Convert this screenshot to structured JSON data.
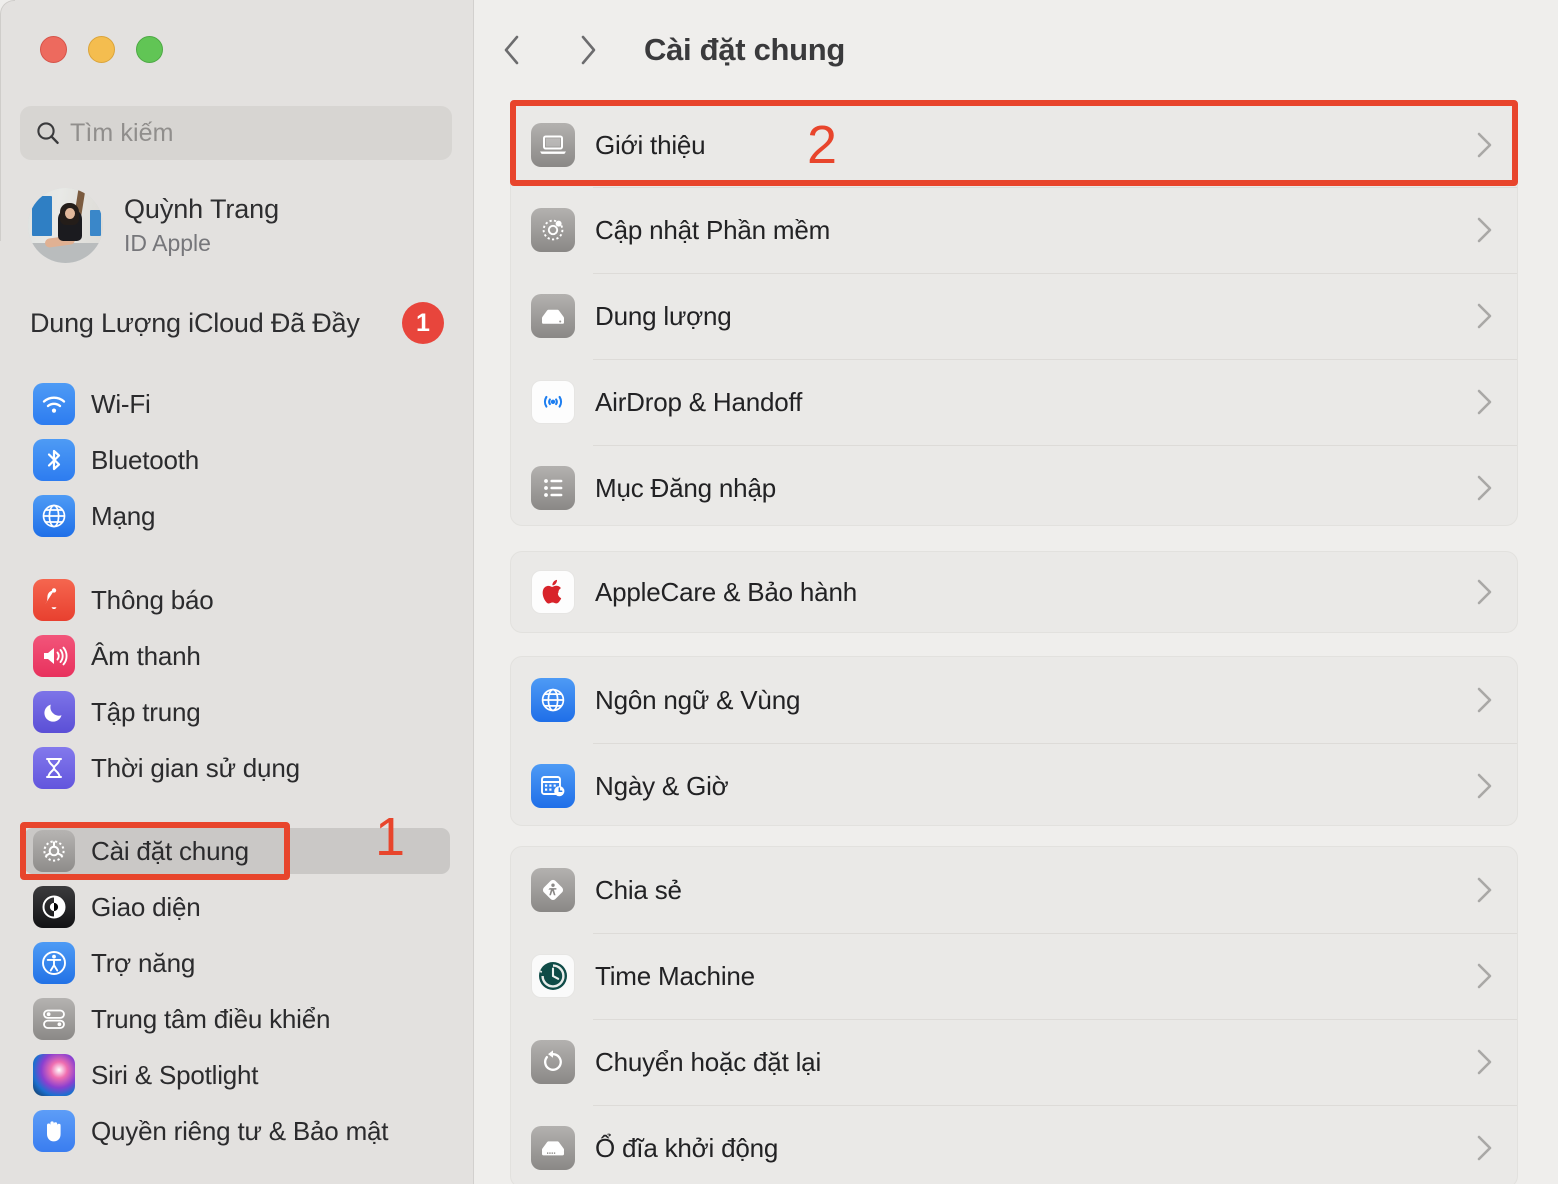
{
  "window": {
    "traffic_lights": [
      "close",
      "minimize",
      "zoom"
    ],
    "colors": {
      "close": "#ed6a5e",
      "minimize": "#f4bd4f",
      "zoom": "#61c555",
      "accent_annotation": "#e8452c",
      "badge_red": "#e8453c",
      "sidebar_bg": "#e3e1df",
      "content_bg": "#efeeec",
      "card_bg": "#eae9e7"
    }
  },
  "sidebar": {
    "search": {
      "placeholder": "Tìm kiếm",
      "icon": "search-icon"
    },
    "profile": {
      "name": "Quỳnh Trang",
      "subtitle": "ID Apple",
      "avatar": "user-avatar"
    },
    "icloud_notice": {
      "label": "Dung Lượng iCloud Đã Đầy",
      "badge": "1"
    },
    "groups": [
      {
        "items": [
          {
            "label": "Wi-Fi",
            "icon": "wifi-icon",
            "selected": false
          },
          {
            "label": "Bluetooth",
            "icon": "bluetooth-icon",
            "selected": false
          },
          {
            "label": "Mạng",
            "icon": "network-icon",
            "selected": false
          }
        ]
      },
      {
        "items": [
          {
            "label": "Thông báo",
            "icon": "notifications-icon",
            "selected": false
          },
          {
            "label": "Âm thanh",
            "icon": "sound-icon",
            "selected": false
          },
          {
            "label": "Tập trung",
            "icon": "focus-icon",
            "selected": false
          },
          {
            "label": "Thời gian sử dụng",
            "icon": "screen-time-icon",
            "selected": false
          }
        ]
      },
      {
        "items": [
          {
            "label": "Cài đặt chung",
            "icon": "general-gear-icon",
            "selected": true
          },
          {
            "label": "Giao diện",
            "icon": "appearance-icon",
            "selected": false
          },
          {
            "label": "Trợ năng",
            "icon": "accessibility-icon",
            "selected": false
          },
          {
            "label": "Trung tâm điều khiển",
            "icon": "control-center-icon",
            "selected": false
          },
          {
            "label": "Siri & Spotlight",
            "icon": "siri-icon",
            "selected": false
          },
          {
            "label": "Quyền riêng tư & Bảo mật",
            "icon": "privacy-hand-icon",
            "selected": false
          }
        ]
      }
    ]
  },
  "main": {
    "back_button": "back-chevron",
    "forward_button": "forward-chevron",
    "title": "Cài đặt chung",
    "groups": [
      {
        "rows": [
          {
            "label": "Giới thiệu",
            "icon": "about-laptop-icon",
            "highlighted": true
          },
          {
            "label": "Cập nhật Phần mềm",
            "icon": "software-update-icon",
            "highlighted": false
          },
          {
            "label": "Dung lượng",
            "icon": "storage-disk-icon",
            "highlighted": false
          },
          {
            "label": "AirDrop & Handoff",
            "icon": "airdrop-icon",
            "highlighted": false
          },
          {
            "label": "Mục Đăng nhập",
            "icon": "login-items-icon",
            "highlighted": false
          }
        ]
      },
      {
        "rows": [
          {
            "label": "AppleCare & Bảo hành",
            "icon": "apple-logo-icon",
            "highlighted": false
          }
        ]
      },
      {
        "rows": [
          {
            "label": "Ngôn ngữ & Vùng",
            "icon": "language-globe-icon",
            "highlighted": false
          },
          {
            "label": "Ngày & Giờ",
            "icon": "date-time-icon",
            "highlighted": false
          }
        ]
      },
      {
        "rows": [
          {
            "label": "Chia sẻ",
            "icon": "sharing-icon",
            "highlighted": false
          },
          {
            "label": "Time Machine",
            "icon": "time-machine-icon",
            "highlighted": false
          },
          {
            "label": "Chuyển hoặc đặt lại",
            "icon": "transfer-reset-icon",
            "highlighted": false
          },
          {
            "label": "Ổ đĩa khởi động",
            "icon": "startup-disk-icon",
            "highlighted": false
          }
        ]
      }
    ]
  },
  "annotations": [
    {
      "number": "1",
      "target": "sidebar-item-cai-dat-chung"
    },
    {
      "number": "2",
      "target": "main-row-gioi-thieu"
    }
  ]
}
